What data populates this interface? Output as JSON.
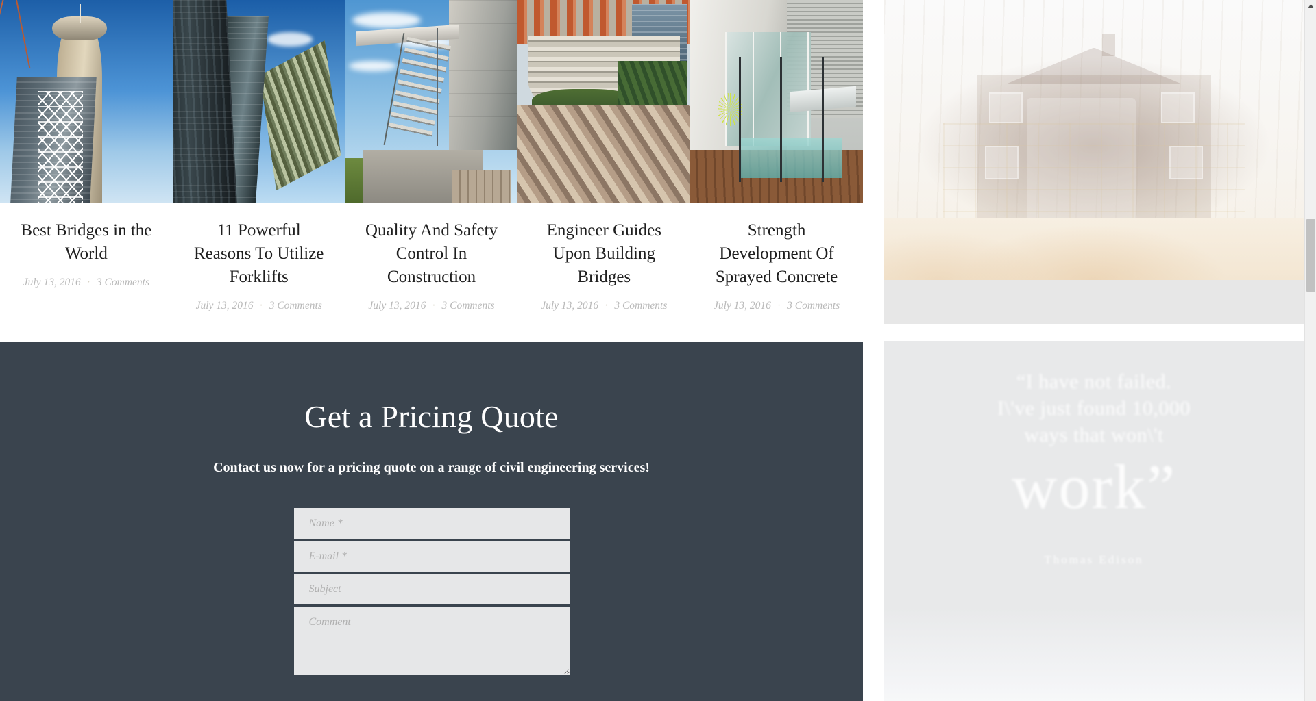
{
  "posts": [
    {
      "title": "Best Bridges in the World",
      "date": "July 13, 2016",
      "separator": "·",
      "comments": "3 Comments",
      "thumb_icon": "tower-construction-photo"
    },
    {
      "title": "11 Powerful Reasons To Utilize Forklifts",
      "date": "July 13, 2016",
      "separator": "·",
      "comments": "3 Comments",
      "thumb_icon": "glass-skyscrapers-photo"
    },
    {
      "title": "Quality And Safety Control In Construction",
      "date": "July 13, 2016",
      "separator": "·",
      "comments": "3 Comments",
      "thumb_icon": "concrete-staircase-photo"
    },
    {
      "title": "Engineer Guides Upon Building Bridges",
      "date": "July 13, 2016",
      "separator": "·",
      "comments": "3 Comments",
      "thumb_icon": "hillside-terraces-photo"
    },
    {
      "title": "Strength Development Of Sprayed Concrete",
      "date": "July 13, 2016",
      "separator": "·",
      "comments": "3 Comments",
      "thumb_icon": "modern-house-pool-photo"
    }
  ],
  "quote_section": {
    "heading": "Get a Pricing Quote",
    "subheading": "Contact us now for a pricing quote on a range of civil engineering services!",
    "background_color": "#3a444e",
    "form": {
      "name_placeholder": "Name *",
      "email_placeholder": "E-mail *",
      "subject_placeholder": "Subject",
      "comment_placeholder": "Comment",
      "name_value": "",
      "email_value": "",
      "subject_value": "",
      "comment_value": ""
    }
  },
  "right_panel": {
    "hero_icon": "house-under-construction-photo",
    "quote_line_1": "“I have not failed.",
    "quote_line_2": "I\\'ve just found 10,000",
    "quote_line_3": "ways that won\\'t",
    "quote_emphasis": "work”",
    "author": "Thomas Edison"
  },
  "scrollbar": {
    "up_arrow_icon": "scroll-up-arrow-icon",
    "thumb_icon": "scrollbar-thumb"
  }
}
